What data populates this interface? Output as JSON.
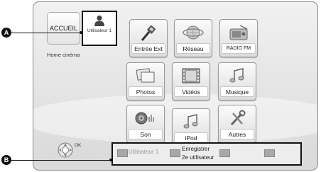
{
  "header": {
    "home_label": "ACCUEIL",
    "user_label": "Utilisateur 1",
    "subtitle": "Home cinéma"
  },
  "tiles": {
    "entree_ext": "Entrée Ext",
    "reseau": "Réseau",
    "radio_fm": "RADIO FM",
    "photos": "Photos",
    "videos": "Vidéos",
    "musique": "Musique",
    "son": "Son",
    "ipod": "iPod",
    "autres": "Autres"
  },
  "footer": {
    "ok_label": "OK",
    "user_label": "Utilisateur 1",
    "register_line1": "Enregistrer",
    "register_line2": "2e utilisateur"
  },
  "callouts": {
    "a": "A",
    "b": "B"
  },
  "colors": {
    "screen_bg": "#e4e4e4",
    "highlight_border": "#111111",
    "callout_bg": "#111111"
  },
  "icons": {
    "user": "person-icon",
    "entree_ext": "hdmi-cable-icon",
    "reseau": "globe-network-icon",
    "radio_fm": "radio-icon",
    "photos": "photo-frames-icon",
    "videos": "film-strip-icon",
    "musique": "music-note-icon",
    "son": "speaker-icon",
    "ipod": "music-note-icon",
    "autres": "tools-icon",
    "remote": "remote-dpad-icon"
  }
}
